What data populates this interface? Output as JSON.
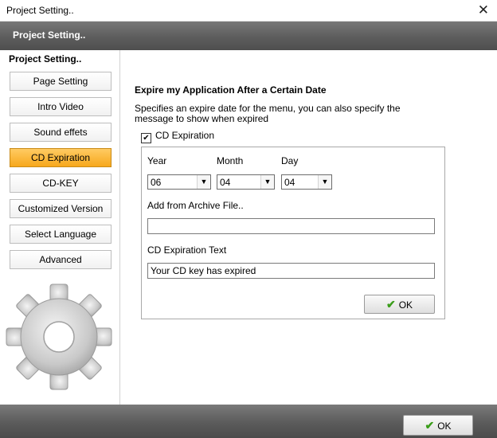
{
  "window": {
    "title": "Project Setting..",
    "close_glyph": "✕"
  },
  "header": {
    "title": "Project Setting.."
  },
  "sidebar": {
    "heading": "Project Setting..",
    "items": [
      {
        "label": "Page Setting"
      },
      {
        "label": "Intro Video"
      },
      {
        "label": "Sound effets"
      },
      {
        "label": "CD Expiration",
        "active": true
      },
      {
        "label": "CD-KEY"
      },
      {
        "label": "Customized Version"
      },
      {
        "label": "Select Language"
      },
      {
        "label": "Advanced"
      }
    ]
  },
  "main": {
    "section_title": "Expire my Application After a Certain Date",
    "description": "Specifies an expire date for the menu, you can also specify the message to show when expired",
    "checkbox": {
      "label": "CD Expiration",
      "checked": true,
      "mark": "✔"
    },
    "year": {
      "label": "Year",
      "value": "06"
    },
    "month": {
      "label": "Month",
      "value": "04"
    },
    "day": {
      "label": "Day",
      "value": "04"
    },
    "archive": {
      "label": "Add from Archive File..",
      "value": ""
    },
    "expiration_text": {
      "label": "CD Expiration Text",
      "value": "Your CD key has expired"
    },
    "ok_label": "OK"
  },
  "footer": {
    "ok_label": "OK"
  },
  "icons": {
    "dropdown": "▼",
    "check": "✔"
  },
  "colors": {
    "accent_active": "#f7a81c",
    "header_bg": "#5d5d5d",
    "ok_check": "#3a9d1a"
  }
}
